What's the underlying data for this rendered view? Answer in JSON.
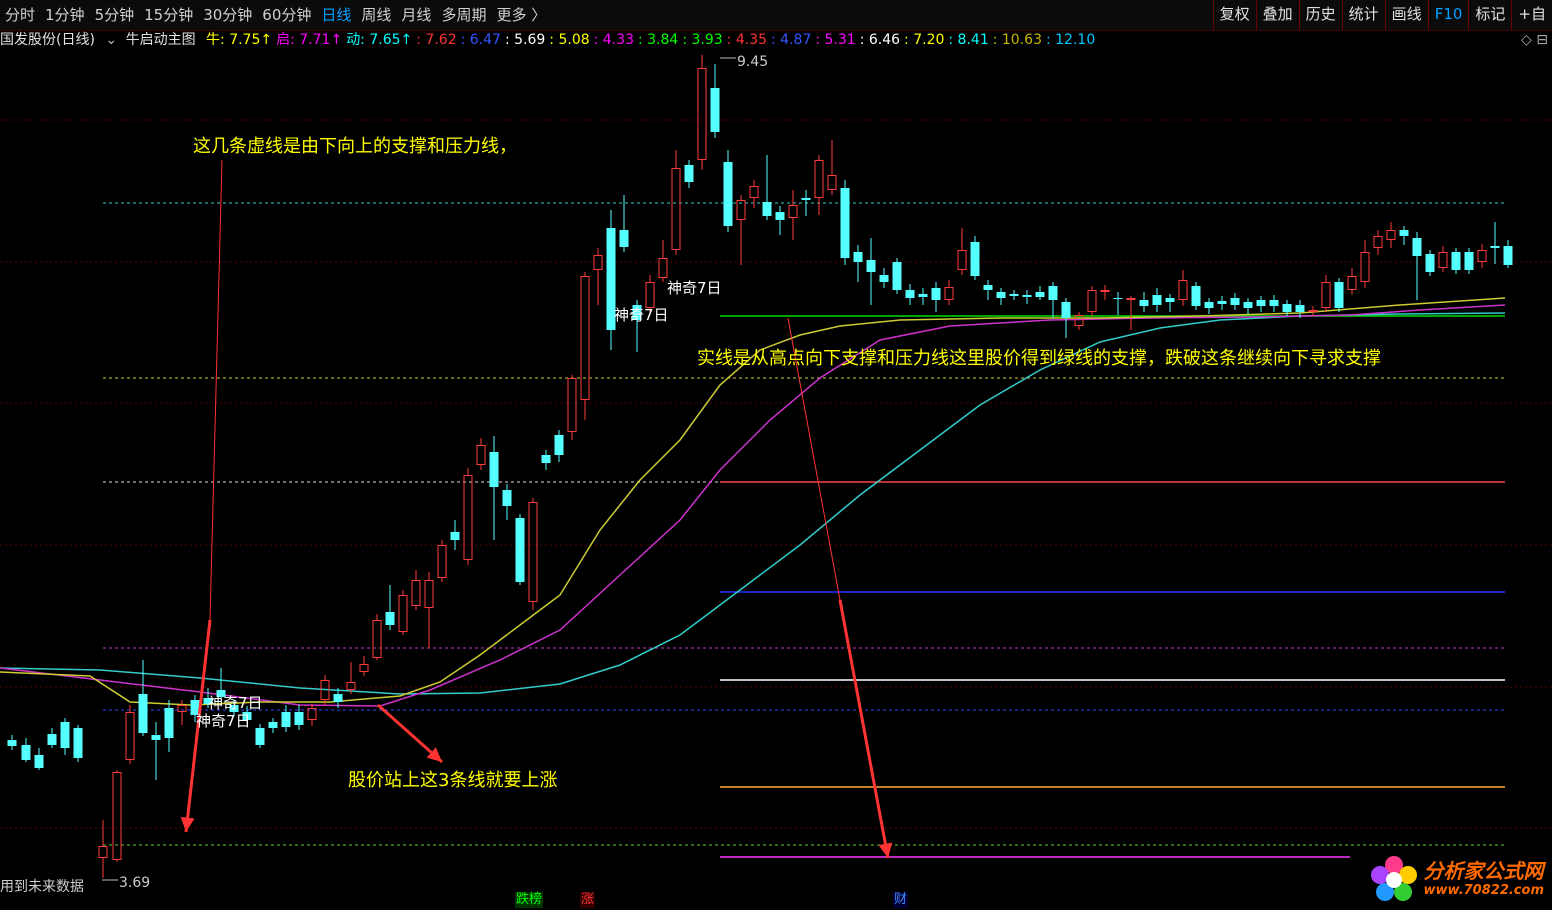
{
  "toolbar": {
    "periods": [
      "分时",
      "1分钟",
      "5分钟",
      "15分钟",
      "30分钟",
      "60分钟",
      "日线",
      "周线",
      "月线",
      "多周期",
      "更多 〉"
    ],
    "active_period": "日线",
    "buttons": [
      "复权",
      "叠加",
      "历史",
      "统计",
      "画线",
      "F10",
      "标记",
      "+自"
    ]
  },
  "infobar": {
    "stock": "国发股份(日线)",
    "indicator": "牛启动主图",
    "items": [
      {
        "text": "牛: 7.75↑",
        "color": "#ffff00"
      },
      {
        "text": "启: 7.71↑",
        "color": "#ff00ff"
      },
      {
        "text": "动: 7.65↑",
        "color": "#00ffff"
      },
      {
        "text": ": 7.62",
        "color": "#ff3333"
      },
      {
        "text": ": 6.47",
        "color": "#3355ff"
      },
      {
        "text": ": 5.69",
        "color": "#ffffff"
      },
      {
        "text": ": 5.08",
        "color": "#ffff00"
      },
      {
        "text": ": 4.33",
        "color": "#ff00ff"
      },
      {
        "text": ": 3.84",
        "color": "#00ff00"
      },
      {
        "text": ": 3.93",
        "color": "#00ff00"
      },
      {
        "text": ": 4.35",
        "color": "#ff3333"
      },
      {
        "text": ": 4.87",
        "color": "#3355ff"
      },
      {
        "text": ": 5.31",
        "color": "#ff00ff"
      },
      {
        "text": ": 6.46",
        "color": "#ffffff"
      },
      {
        "text": ": 7.20",
        "color": "#ffff00"
      },
      {
        "text": ": 8.41",
        "color": "#00ffff"
      },
      {
        "text": ": 10.63",
        "color": "#c8b400"
      },
      {
        "text": ": 12.10",
        "color": "#00c8ff"
      }
    ],
    "right": "◇ ⊟"
  },
  "annotations": {
    "top": "这几条虚线是由下向上的支撑和压力线，",
    "middle": "实线是从高点向下支撑和压力线这里股价得到绿线的支撑，跌破这条继续向下寻求支撑",
    "bottom": "股价站上这3条线就要上涨"
  },
  "signal_labels": [
    "神奇7日",
    "神奇7日",
    "神奇7日",
    "神奇7日"
  ],
  "price_labels": {
    "high": "9.45",
    "low": "3.69"
  },
  "bottom_note": "用到未来数据",
  "badges": [
    {
      "text": "跌榜",
      "color": "#00ff00",
      "bg": "#003300"
    },
    {
      "text": "涨",
      "color": "#ff3333",
      "bg": "#330000"
    },
    {
      "text": "财",
      "color": "#4488ff",
      "bg": "#000033"
    }
  ],
  "logo": {
    "name": "分析家公式网",
    "url": "www.70822.com"
  },
  "colors": {
    "up": "#ff3c3c",
    "down": "#54ffff"
  }
}
